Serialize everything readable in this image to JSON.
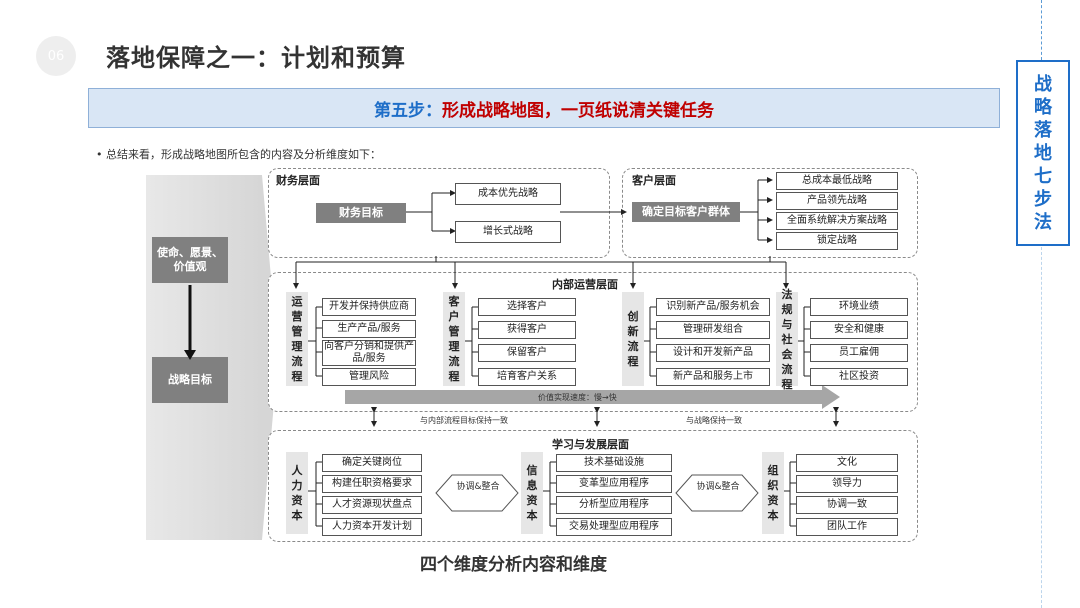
{
  "page": {
    "number": "06",
    "title": "落地保障之一：计划和预算",
    "side_label": [
      "战",
      "略",
      "落",
      "地",
      "七",
      "步",
      "法"
    ],
    "banner_prefix": "第五步：",
    "banner_main": "形成战略地图，一页纸说清关键任务",
    "intro": "• 总结来看，形成战略地图所包含的内容及分析维度如下：",
    "caption": "四个维度分析内容和维度"
  },
  "left_panel": {
    "top": "使命、愿景、价值观",
    "bottom": "战略目标"
  },
  "finance": {
    "title": "财务层面",
    "goal": "财务目标",
    "items": [
      "成本优先战略",
      "增长式战略"
    ]
  },
  "customer": {
    "title": "客户层面",
    "goal": "确定目标客户群体",
    "items": [
      "总成本最低战略",
      "产品领先战略",
      "全面系统解决方案战略",
      "锁定战略"
    ]
  },
  "internal": {
    "title": "内部运营层面",
    "groups": [
      {
        "label": "运营管理流程",
        "items": [
          "开发并保持供应商",
          "生产产品/服务",
          "向客户分销和提供产品/服务",
          "管理风险"
        ]
      },
      {
        "label": "客户管理流程",
        "items": [
          "选择客户",
          "获得客户",
          "保留客户",
          "培育客户关系"
        ]
      },
      {
        "label": "创新流程",
        "items": [
          "识别新产品/服务机会",
          "管理研发组合",
          "设计和开发新产品",
          "新产品和服务上市"
        ]
      },
      {
        "label": "法规与社会流程",
        "items": [
          "环境业绩",
          "安全和健康",
          "员工雇佣",
          "社区投资"
        ]
      }
    ],
    "speed": "价值实现速度：慢→快"
  },
  "links": {
    "left": "与内部流程目标保持一致",
    "right": "与战略保持一致"
  },
  "learning": {
    "title": "学习与发展层面",
    "groups": [
      {
        "label": "人力资本",
        "items": [
          "确定关键岗位",
          "构建任职资格要求",
          "人才资源现状盘点",
          "人力资本开发计划"
        ]
      },
      {
        "label": "信息资本",
        "items": [
          "技术基础设施",
          "变革型应用程序",
          "分析型应用程序",
          "交易处理型应用程序"
        ]
      },
      {
        "label": "组织资本",
        "items": [
          "文化",
          "领导力",
          "协调一致",
          "团队工作"
        ]
      }
    ],
    "coord": "协调&整合"
  }
}
